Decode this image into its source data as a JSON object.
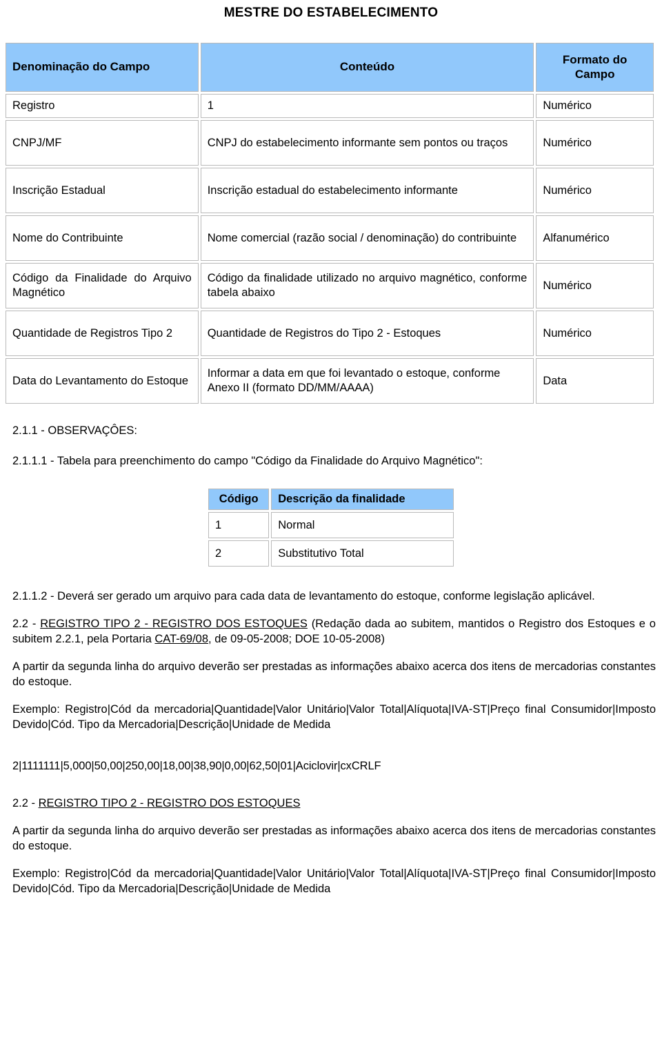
{
  "document": {
    "title": "MESTRE DO ESTABELECIMENTO",
    "header_bg": "#91c8fb",
    "border_color": "#b9b9b9",
    "text_color": "#000000"
  },
  "field_table": {
    "headers": {
      "col1": "Denominação do Campo",
      "col2": "Conteúdo",
      "col3": "Formato do Campo"
    },
    "rows": [
      {
        "field": "Registro",
        "content": "1",
        "format": "Numérico"
      },
      {
        "field": "CNPJ/MF",
        "content": "CNPJ do estabelecimento informante sem pontos ou traços",
        "format": "Numérico"
      },
      {
        "field": "Inscrição Estadual",
        "content": "Inscrição estadual do estabelecimento informante",
        "format": "Numérico"
      },
      {
        "field": "Nome do Contribuinte",
        "content": "Nome comercial (razão social / denominação) do contribuinte",
        "format": "Alfanumérico"
      },
      {
        "field": "Código da Finalidade do Arquivo Magnético",
        "content": "Código da finalidade utilizado no arquivo magnético, conforme tabela abaixo",
        "format": "Numérico"
      },
      {
        "field": "Quantidade de Registros Tipo 2",
        "content": "Quantidade de Registros do Tipo 2 - Estoques",
        "format": "Numérico"
      },
      {
        "field": "Data do Levantamento do Estoque",
        "content": "Informar a data em que foi levantado o estoque, conforme Anexo II (formato DD/MM/AAAA)",
        "format": "Data"
      }
    ]
  },
  "sections": {
    "obs_heading": "2.1.1 - OBSERVAÇÔES:",
    "obs_sub_heading": "2.1.1.1 - Tabela para preenchimento do campo \"Código da Finalidade do Arquivo Magnético\":",
    "item_2112": "2.1.1.2 - Deverá ser gerado um arquivo para cada data de levantamento do estoque, conforme legislação aplicável.",
    "item_22_number": "2.2 - ",
    "item_22_underlined": "REGISTRO TIPO 2 - REGISTRO DOS ESTOQUES",
    "item_22_rest_a": " (Redação dada ao subitem, mantidos o Registro dos Estoques e o subitem 2.2.1, pela Portaria ",
    "item_22_portaria": "CAT-69/08",
    "item_22_rest_b": ", de 09-05-2008; DOE 10-05-2008)",
    "paragraph_segunda_linha": "A partir da segunda linha do arquivo deverão ser prestadas as informações abaixo acerca dos itens de mercadorias constantes do estoque.",
    "exemplo_line": "Exemplo: Registro|Cód da mercadoria|Quantidade|Valor Unitário|Valor Total|Alíquota|IVA-ST|Preço final Consumidor|Imposto Devido|Cód. Tipo da Mercadoria|Descrição|Unidade de Medida",
    "data_example": "2|1111111|5,000|50,00|250,00|18,00|38,90|0,00|62,50|01|Aciclovir|cxCRLF",
    "item_22_repeat_number": "2.2 - ",
    "item_22_repeat_underlined": "REGISTRO TIPO 2 - REGISTRO DOS ESTOQUES",
    "paragraph_segunda_linha_2": "A partir da segunda linha do arquivo deverão ser prestadas as informações abaixo acerca dos itens de mercadorias constantes do estoque.",
    "exemplo_line_2": "Exemplo: Registro|Cód da mercadoria|Quantidade|Valor Unitário|Valor Total|Alíquota|IVA-ST|Preço final Consumidor|Imposto Devido|Cód. Tipo da Mercadoria|Descrição|Unidade de Medida"
  },
  "code_table": {
    "headers": {
      "code": "Código",
      "description": "Descrição da finalidade"
    },
    "rows": [
      {
        "code": "1",
        "description": "Normal"
      },
      {
        "code": "2",
        "description": "Substitutivo Total"
      }
    ]
  }
}
